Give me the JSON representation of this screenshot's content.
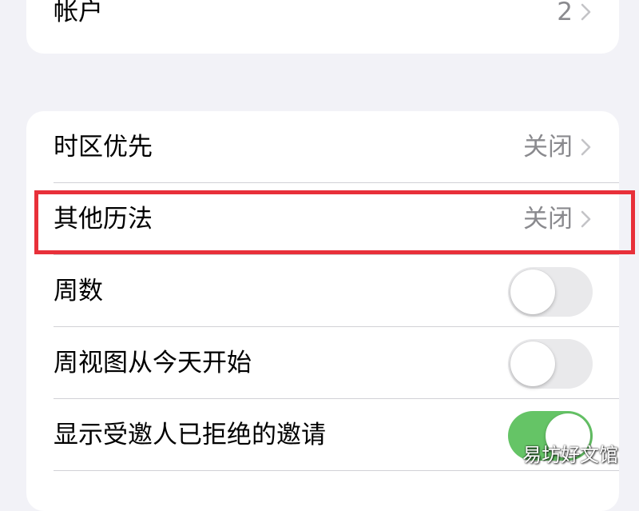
{
  "account_section": {
    "label": "帐户",
    "value": "2"
  },
  "main_section": {
    "rows": [
      {
        "label": "时区优先",
        "value": "关闭",
        "type": "disclosure"
      },
      {
        "label": "其他历法",
        "value": "关闭",
        "type": "disclosure",
        "highlighted": true
      },
      {
        "label": "周数",
        "type": "toggle",
        "on": false
      },
      {
        "label": "周视图从今天开始",
        "type": "toggle",
        "on": false
      },
      {
        "label": "显示受邀人已拒绝的邀请",
        "type": "toggle",
        "on": true
      }
    ]
  },
  "icons": {
    "disclosure": "chevron-right-icon"
  },
  "colors": {
    "background": "#f2f2f7",
    "card": "#ffffff",
    "toggle_on": "#65c466",
    "toggle_off": "#e9e9eb",
    "secondary_text": "#8a8a8e",
    "highlight": "#e8303a"
  },
  "watermark": "易坊好文馆"
}
